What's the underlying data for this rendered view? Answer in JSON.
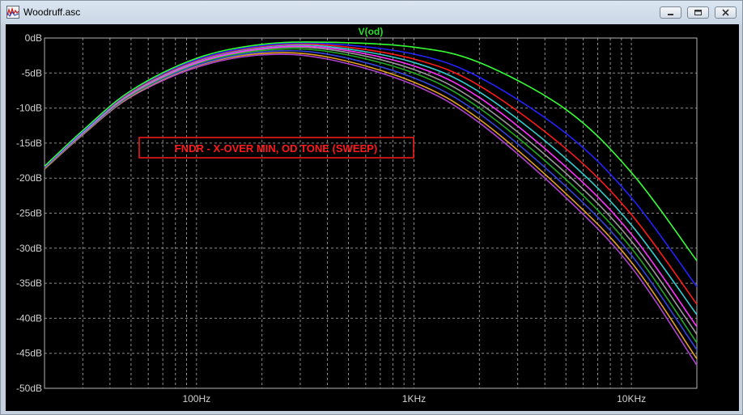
{
  "window": {
    "title": "Woodruff.asc",
    "icons": [
      "waveform-app-icon",
      "minimize-icon",
      "restore-icon",
      "close-icon"
    ]
  },
  "colors": {
    "plot_bg": "#000000",
    "grid": "#8c8c8c",
    "axis_text": "#d2d2d2",
    "trace_label": "#22e022",
    "annotation": "#ff1a1a"
  },
  "annotation": "FNDR - X-OVER MIN, OD TONE (SWEEP)",
  "chart_data": {
    "type": "line",
    "title": "V(od)",
    "xlabel": "",
    "ylabel": "",
    "x_scale": "log",
    "xlim": [
      20,
      20000
    ],
    "ylim": [
      -50,
      0
    ],
    "grid": true,
    "x_ticks": [
      {
        "value": 100,
        "label": "100Hz"
      },
      {
        "value": 1000,
        "label": "1KHz"
      },
      {
        "value": 10000,
        "label": "10KHz"
      }
    ],
    "y_ticks": [
      {
        "value": 0,
        "label": "0dB"
      },
      {
        "value": -5,
        "label": "-5dB"
      },
      {
        "value": -10,
        "label": "-10dB"
      },
      {
        "value": -15,
        "label": "-15dB"
      },
      {
        "value": -20,
        "label": "-20dB"
      },
      {
        "value": -25,
        "label": "-25dB"
      },
      {
        "value": -30,
        "label": "-30dB"
      },
      {
        "value": -35,
        "label": "-35dB"
      },
      {
        "value": -40,
        "label": "-40dB"
      },
      {
        "value": -45,
        "label": "-45dB"
      },
      {
        "value": -50,
        "label": "-50dB"
      }
    ],
    "x": [
      20,
      30,
      50,
      100,
      200,
      400,
      1000,
      2000,
      5000,
      10000,
      20000
    ],
    "series": [
      {
        "color": "#33ff33",
        "values": [
          -18.3,
          -13.2,
          -7.5,
          -2.9,
          -0.9,
          -0.6,
          -1.3,
          -3.5,
          -10.2,
          -19.2,
          -31.8
        ]
      },
      {
        "color": "#2222ff",
        "values": [
          -18.4,
          -13.3,
          -7.6,
          -3.1,
          -1.1,
          -0.8,
          -2.3,
          -5.6,
          -13.6,
          -22.8,
          -35.5
        ]
      },
      {
        "color": "#ff1a1a",
        "values": [
          -18.4,
          -13.3,
          -7.7,
          -3.2,
          -1.2,
          -1.0,
          -3.0,
          -6.8,
          -15.8,
          -25.2,
          -38.0
        ]
      },
      {
        "color": "#33cccc",
        "values": [
          -18.4,
          -13.4,
          -7.8,
          -3.3,
          -1.3,
          -1.2,
          -3.5,
          -7.7,
          -17.2,
          -26.7,
          -39.5
        ]
      },
      {
        "color": "#ff33ff",
        "values": [
          -18.5,
          -13.5,
          -7.9,
          -3.5,
          -1.5,
          -1.4,
          -4.0,
          -8.5,
          -18.4,
          -28.0,
          -41.2
        ]
      },
      {
        "color": "#999999",
        "values": [
          -18.5,
          -13.6,
          -8.0,
          -3.6,
          -1.6,
          -1.6,
          -4.5,
          -9.3,
          -19.3,
          -29.0,
          -42.3
        ]
      },
      {
        "color": "#22aa22",
        "values": [
          -18.6,
          -13.6,
          -8.1,
          -3.7,
          -1.8,
          -1.9,
          -5.0,
          -10.0,
          -20.2,
          -30.0,
          -43.5
        ]
      },
      {
        "color": "#3344dd",
        "values": [
          -18.6,
          -13.7,
          -8.2,
          -3.9,
          -2.0,
          -2.3,
          -5.7,
          -10.8,
          -21.2,
          -31.0,
          -44.5
        ]
      },
      {
        "color": "#e6a020",
        "values": [
          -18.7,
          -13.8,
          -8.3,
          -4.0,
          -2.2,
          -2.7,
          -6.3,
          -11.6,
          -22.2,
          -32.0,
          -45.8
        ]
      },
      {
        "color": "#b040d0",
        "values": [
          -18.7,
          -13.8,
          -8.4,
          -4.2,
          -2.4,
          -3.0,
          -6.7,
          -12.1,
          -22.8,
          -32.7,
          -46.7
        ]
      }
    ]
  }
}
